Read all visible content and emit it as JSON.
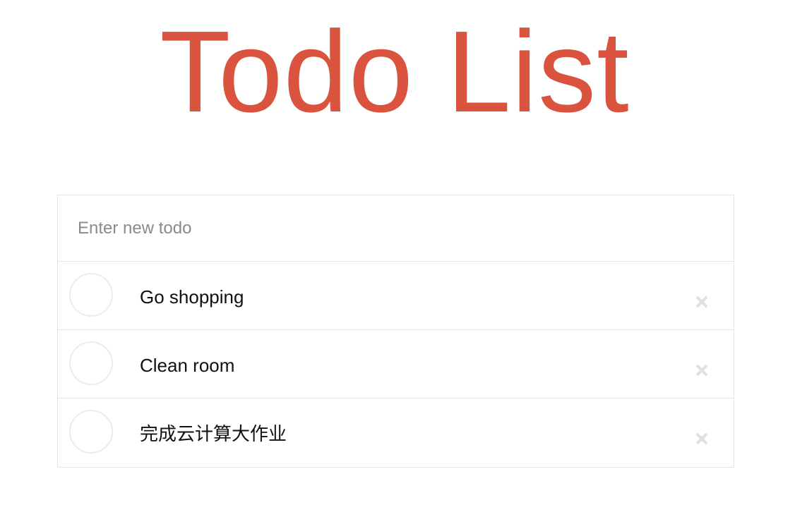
{
  "title": "Todo List",
  "new_todo": {
    "placeholder": "Enter new todo",
    "value": ""
  },
  "todos": [
    {
      "label": "Go shopping",
      "completed": false
    },
    {
      "label": "Clean room",
      "completed": false
    },
    {
      "label": "完成云计算大作业",
      "completed": false
    }
  ],
  "colors": {
    "accent": "#d9533f",
    "border": "#e6e6e6",
    "destroy_icon": "#e0e0e0"
  },
  "icons": {
    "toggle": "circle-checkbox-icon",
    "destroy": "close-icon"
  }
}
